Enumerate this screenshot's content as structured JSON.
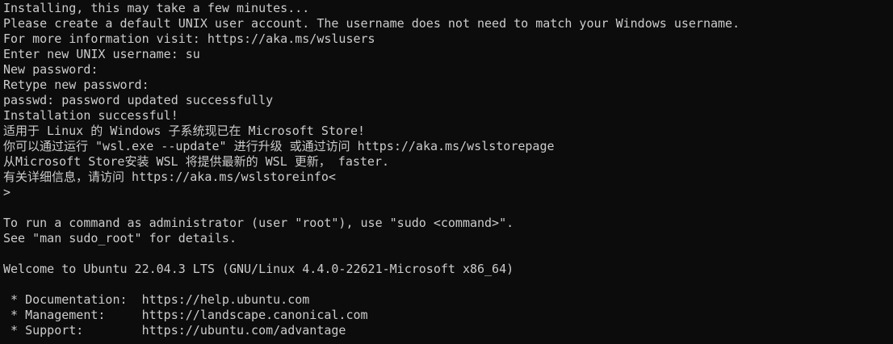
{
  "terminal": {
    "lines": [
      "Installing, this may take a few minutes...",
      "Please create a default UNIX user account. The username does not need to match your Windows username.",
      "For more information visit: https://aka.ms/wslusers",
      "Enter new UNIX username: su",
      "New password:",
      "Retype new password:",
      "passwd: password updated successfully",
      "Installation successful!",
      "适用于 Linux 的 Windows 子系统现已在 Microsoft Store!",
      "你可以通过运行 \"wsl.exe --update\" 进行升级 或通过访问 https://aka.ms/wslstorepage",
      "从Microsoft Store安装 WSL 将提供最新的 WSL 更新， faster.",
      "有关详细信息，请访问 https://aka.ms/wslstoreinfo<",
      ">",
      "",
      "To run a command as administrator (user \"root\"), use \"sudo <command>\".",
      "See \"man sudo_root\" for details.",
      "",
      "Welcome to Ubuntu 22.04.3 LTS (GNU/Linux 4.4.0-22621-Microsoft x86_64)",
      "",
      " * Documentation:  https://help.ubuntu.com",
      " * Management:     https://landscape.canonical.com",
      " * Support:        https://ubuntu.com/advantage"
    ]
  }
}
